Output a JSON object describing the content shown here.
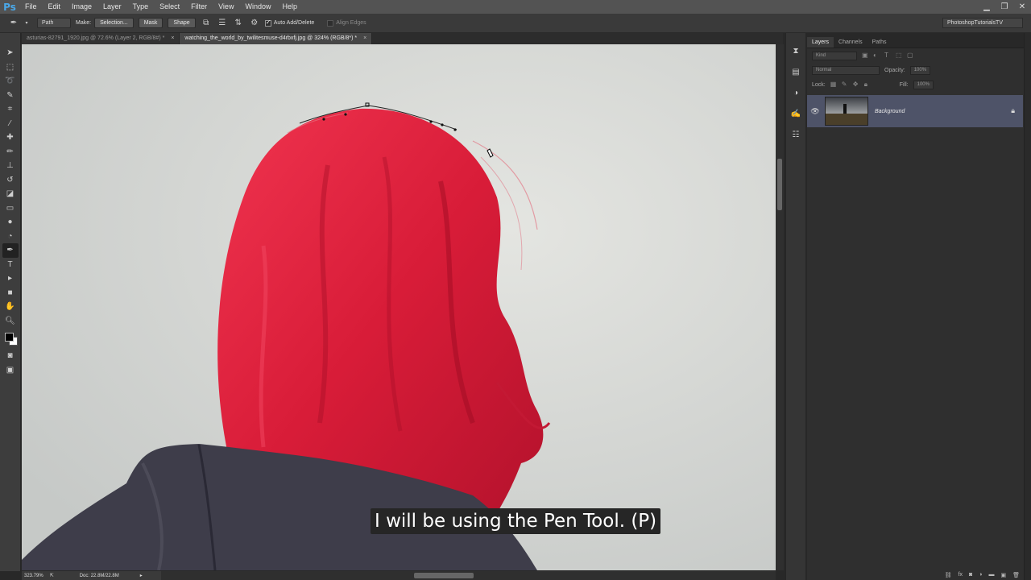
{
  "app": {
    "logo": "Ps"
  },
  "menu": [
    "File",
    "Edit",
    "Image",
    "Layer",
    "Type",
    "Select",
    "Filter",
    "View",
    "Window",
    "Help"
  ],
  "window_controls": {
    "minimize": "▁",
    "restore": "❐",
    "close": "✕"
  },
  "options": {
    "mode": "Path",
    "make_label": "Make:",
    "selection_btn": "Selection...",
    "mask_btn": "Mask",
    "shape_btn": "Shape",
    "auto_add_delete": "Auto Add/Delete",
    "align_edges": "Align Edges",
    "workspace": "PhotoshopTutorialsTV"
  },
  "tabs": [
    {
      "label": "asturias-82791_1920.jpg @ 72.6% (Layer 2, RGB/8#) *",
      "close": "×"
    },
    {
      "label": "watching_the_world_by_twilitesmuse-d4rbxfj.jpg @ 324% (RGB/8*) *",
      "close": "×"
    }
  ],
  "subtitle": "I will be using the Pen Tool. (P)",
  "status": {
    "zoom": "323.79%",
    "doc": "Doc: 22.8M/22.8M"
  },
  "layers_panel": {
    "tabs": [
      "Layers",
      "Channels",
      "Paths"
    ],
    "kind": "Kind",
    "blend_mode": "Normal",
    "opacity_label": "Opacity:",
    "opacity_value": "100%",
    "lock_label": "Lock:",
    "fill_label": "Fill:",
    "fill_value": "100%",
    "layer_name": "Background"
  },
  "colors": {
    "hair": "#e0213d",
    "sky": "#d4d6d3",
    "jacket": "#3e3d4a",
    "selected_layer": "#4e5368"
  }
}
